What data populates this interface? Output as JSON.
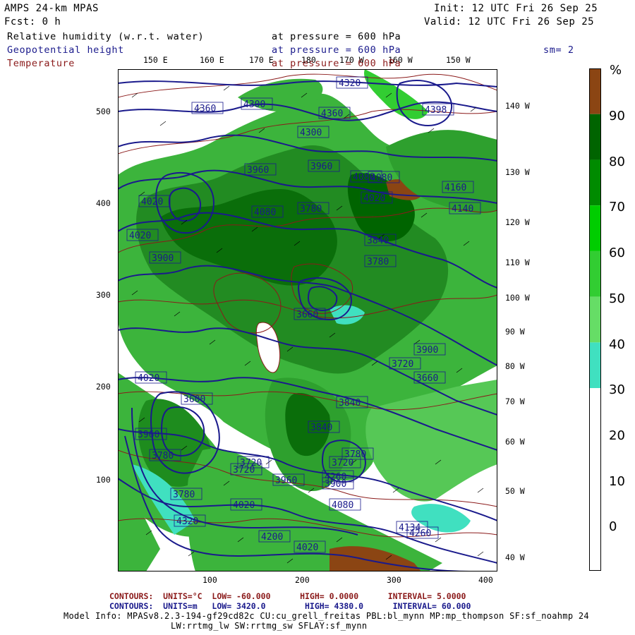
{
  "header": {
    "model": "AMPS 24-km MPAS",
    "forecast": "Fcst:     0 h",
    "init": "Init: 12 UTC Fri 26 Sep 25",
    "valid": "Valid: 12 UTC Fri 26 Sep 25"
  },
  "fields": [
    {
      "name": "Relative humidity (w.r.t. water)",
      "level": "at pressure =  600 hPa",
      "color": "#000000"
    },
    {
      "name": "Geopotential height",
      "level": "at pressure =  600 hPa",
      "color": "#1a1a8c"
    },
    {
      "name": "Temperature",
      "level": "at pressure =  600 hPa",
      "color": "#8b1a1a"
    }
  ],
  "smoothing": "sm= 2",
  "top_lon_labels": [
    "150 E",
    "160 E",
    "170 E",
    "180",
    "170 W",
    "160 W",
    "150 W"
  ],
  "right_lon_labels": [
    "140 W",
    "130 W",
    "120 W",
    "110 W",
    "100 W",
    "90 W",
    "80 W",
    "70 W",
    "60 W",
    "50 W",
    "40 W"
  ],
  "y_ticks": [
    "500",
    "400",
    "300",
    "200",
    "100"
  ],
  "x_ticks": [
    "100",
    "200",
    "300",
    "400"
  ],
  "colorbar": {
    "unit": "%",
    "labels": [
      "90",
      "80",
      "70",
      "60",
      "50",
      "40",
      "30",
      "20",
      "10",
      "0"
    ],
    "colors": [
      "#8b4513",
      "#006400",
      "#008b00",
      "#00cd00",
      "#32cd32",
      "#66dd66",
      "#40e0c0",
      "#ffffff",
      "#ffffff",
      "#ffffff"
    ]
  },
  "height_labels": [
    "4320",
    "4360",
    "4300",
    "4360",
    "4300",
    "4398",
    "4140",
    "4020",
    "4080",
    "3960",
    "4080",
    "4160",
    "4020",
    "3960",
    "3780",
    "3840",
    "4080",
    "4020",
    "3900",
    "3780",
    "3660",
    "3720",
    "3900",
    "3600",
    "4020",
    "3780",
    "3720",
    "3960",
    "3720",
    "3900",
    "3840",
    "3660",
    "3780",
    "3840",
    "3720",
    "3960",
    "3780",
    "4020",
    "4080",
    "4020",
    "4260",
    "4320",
    "4200",
    "4260",
    "4134"
  ],
  "footer": {
    "line1": {
      "kind": "CONTOURS:",
      "units": "UNITS=°C",
      "low": "LOW=  -60.000",
      "high": "HIGH=  0.0000",
      "interval": "INTERVAL=    5.0000"
    },
    "line2": {
      "kind": "CONTOURS:",
      "units": "UNITS=m",
      "low": "LOW=  3420.0",
      "high": "HIGH=  4380.0",
      "interval": "INTERVAL=    60.000"
    },
    "model_info": "Model Info: MPASv8.2.3-194-gf29cd82c CU:cu_grell_freitas PBL:bl_mynn MP:mp_thompson SF:sf_noahmp 24",
    "model_info2": "LW:rrtmg_lw SW:rrtmg_sw SFLAY:sf_mynn",
    "temp_color": "#8b1a1a",
    "height_color": "#1a1a8c"
  }
}
